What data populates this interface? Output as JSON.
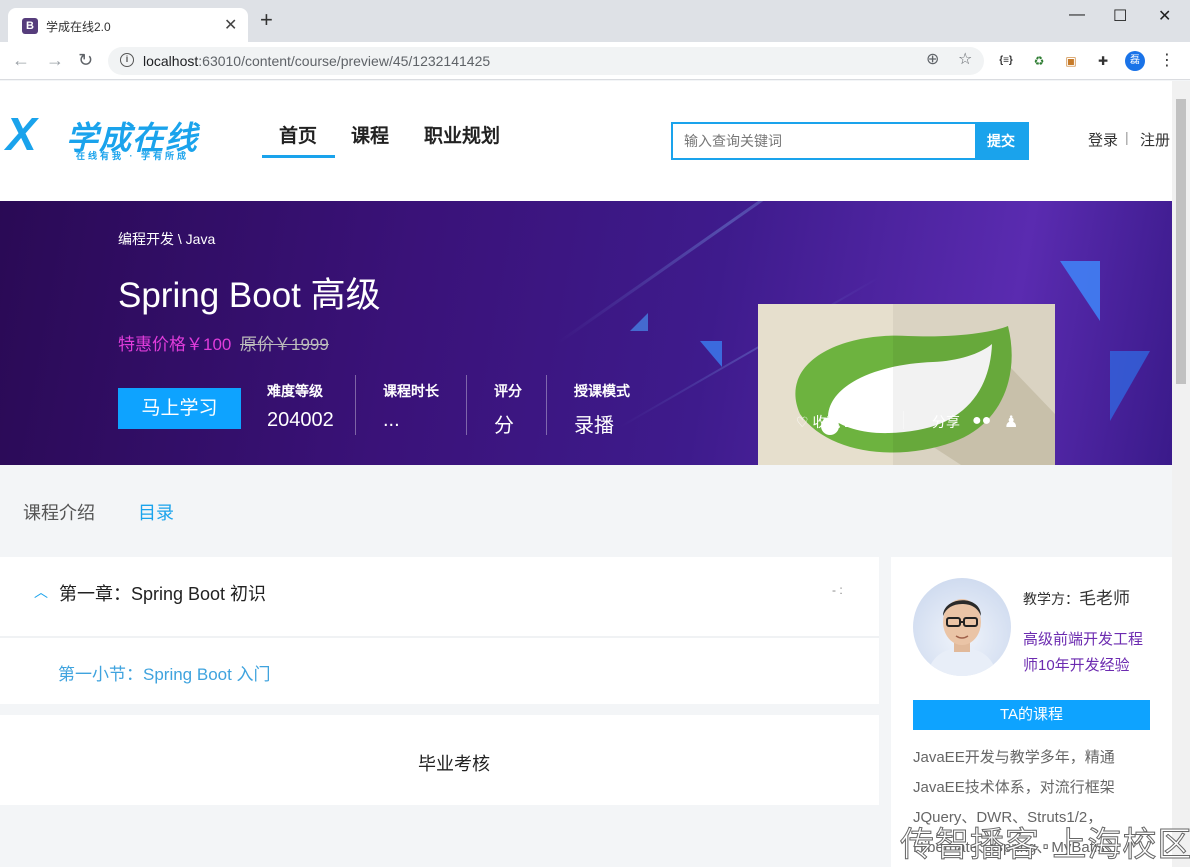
{
  "browser": {
    "tab_favicon": "B",
    "tab_title": "学成在线2.0",
    "url_host": "localhost",
    "url_path": ":63010/content/course/preview/45/1232141425",
    "profile_initial": "磊"
  },
  "header": {
    "logo_text": "学成在线",
    "logo_slogan": "在线有我 · 学有所成",
    "nav": [
      "首页",
      "课程",
      "职业规划"
    ],
    "search_placeholder": "输入查询关键词",
    "search_button": "提交",
    "login": "登录",
    "separator": "|",
    "register": "注册"
  },
  "course": {
    "breadcrumb": "编程开发 \\ Java",
    "title": "Spring Boot 高级",
    "price": "特惠价格￥100",
    "original_price": "原价￥1999",
    "learn_button": "马上学习",
    "stats": [
      {
        "label": "难度等级",
        "value": "204002"
      },
      {
        "label": "课程时长",
        "value": "..."
      },
      {
        "label": "评分",
        "value": "分"
      },
      {
        "label": "授课模式",
        "value": "录播"
      }
    ],
    "collect": "收藏 23",
    "share": "分享"
  },
  "tabs": {
    "intro": "课程介绍",
    "catalog": "目录"
  },
  "catalog": {
    "chapter_title": "第一章：Spring Boot 初识",
    "chapter_meta": "- :",
    "lesson": "第一小节：Spring Boot 入门",
    "exam": "毕业考核"
  },
  "teacher": {
    "name_label": "教学方：",
    "name": "毛老师",
    "position": "高级前端开发工程师10年开发经验",
    "courses_button": "TA的课程",
    "description": "JavaEE开发与教学多年，精通JavaEE技术体系，对流行框架JQuery、DWR、Struts1/2，Hibernate、Spring、MyBatis"
  },
  "watermark": "传智播客·上海校区",
  "colors": {
    "accent": "#1aa3ec",
    "price": "#e03cdb",
    "banner": "#3a1279"
  }
}
